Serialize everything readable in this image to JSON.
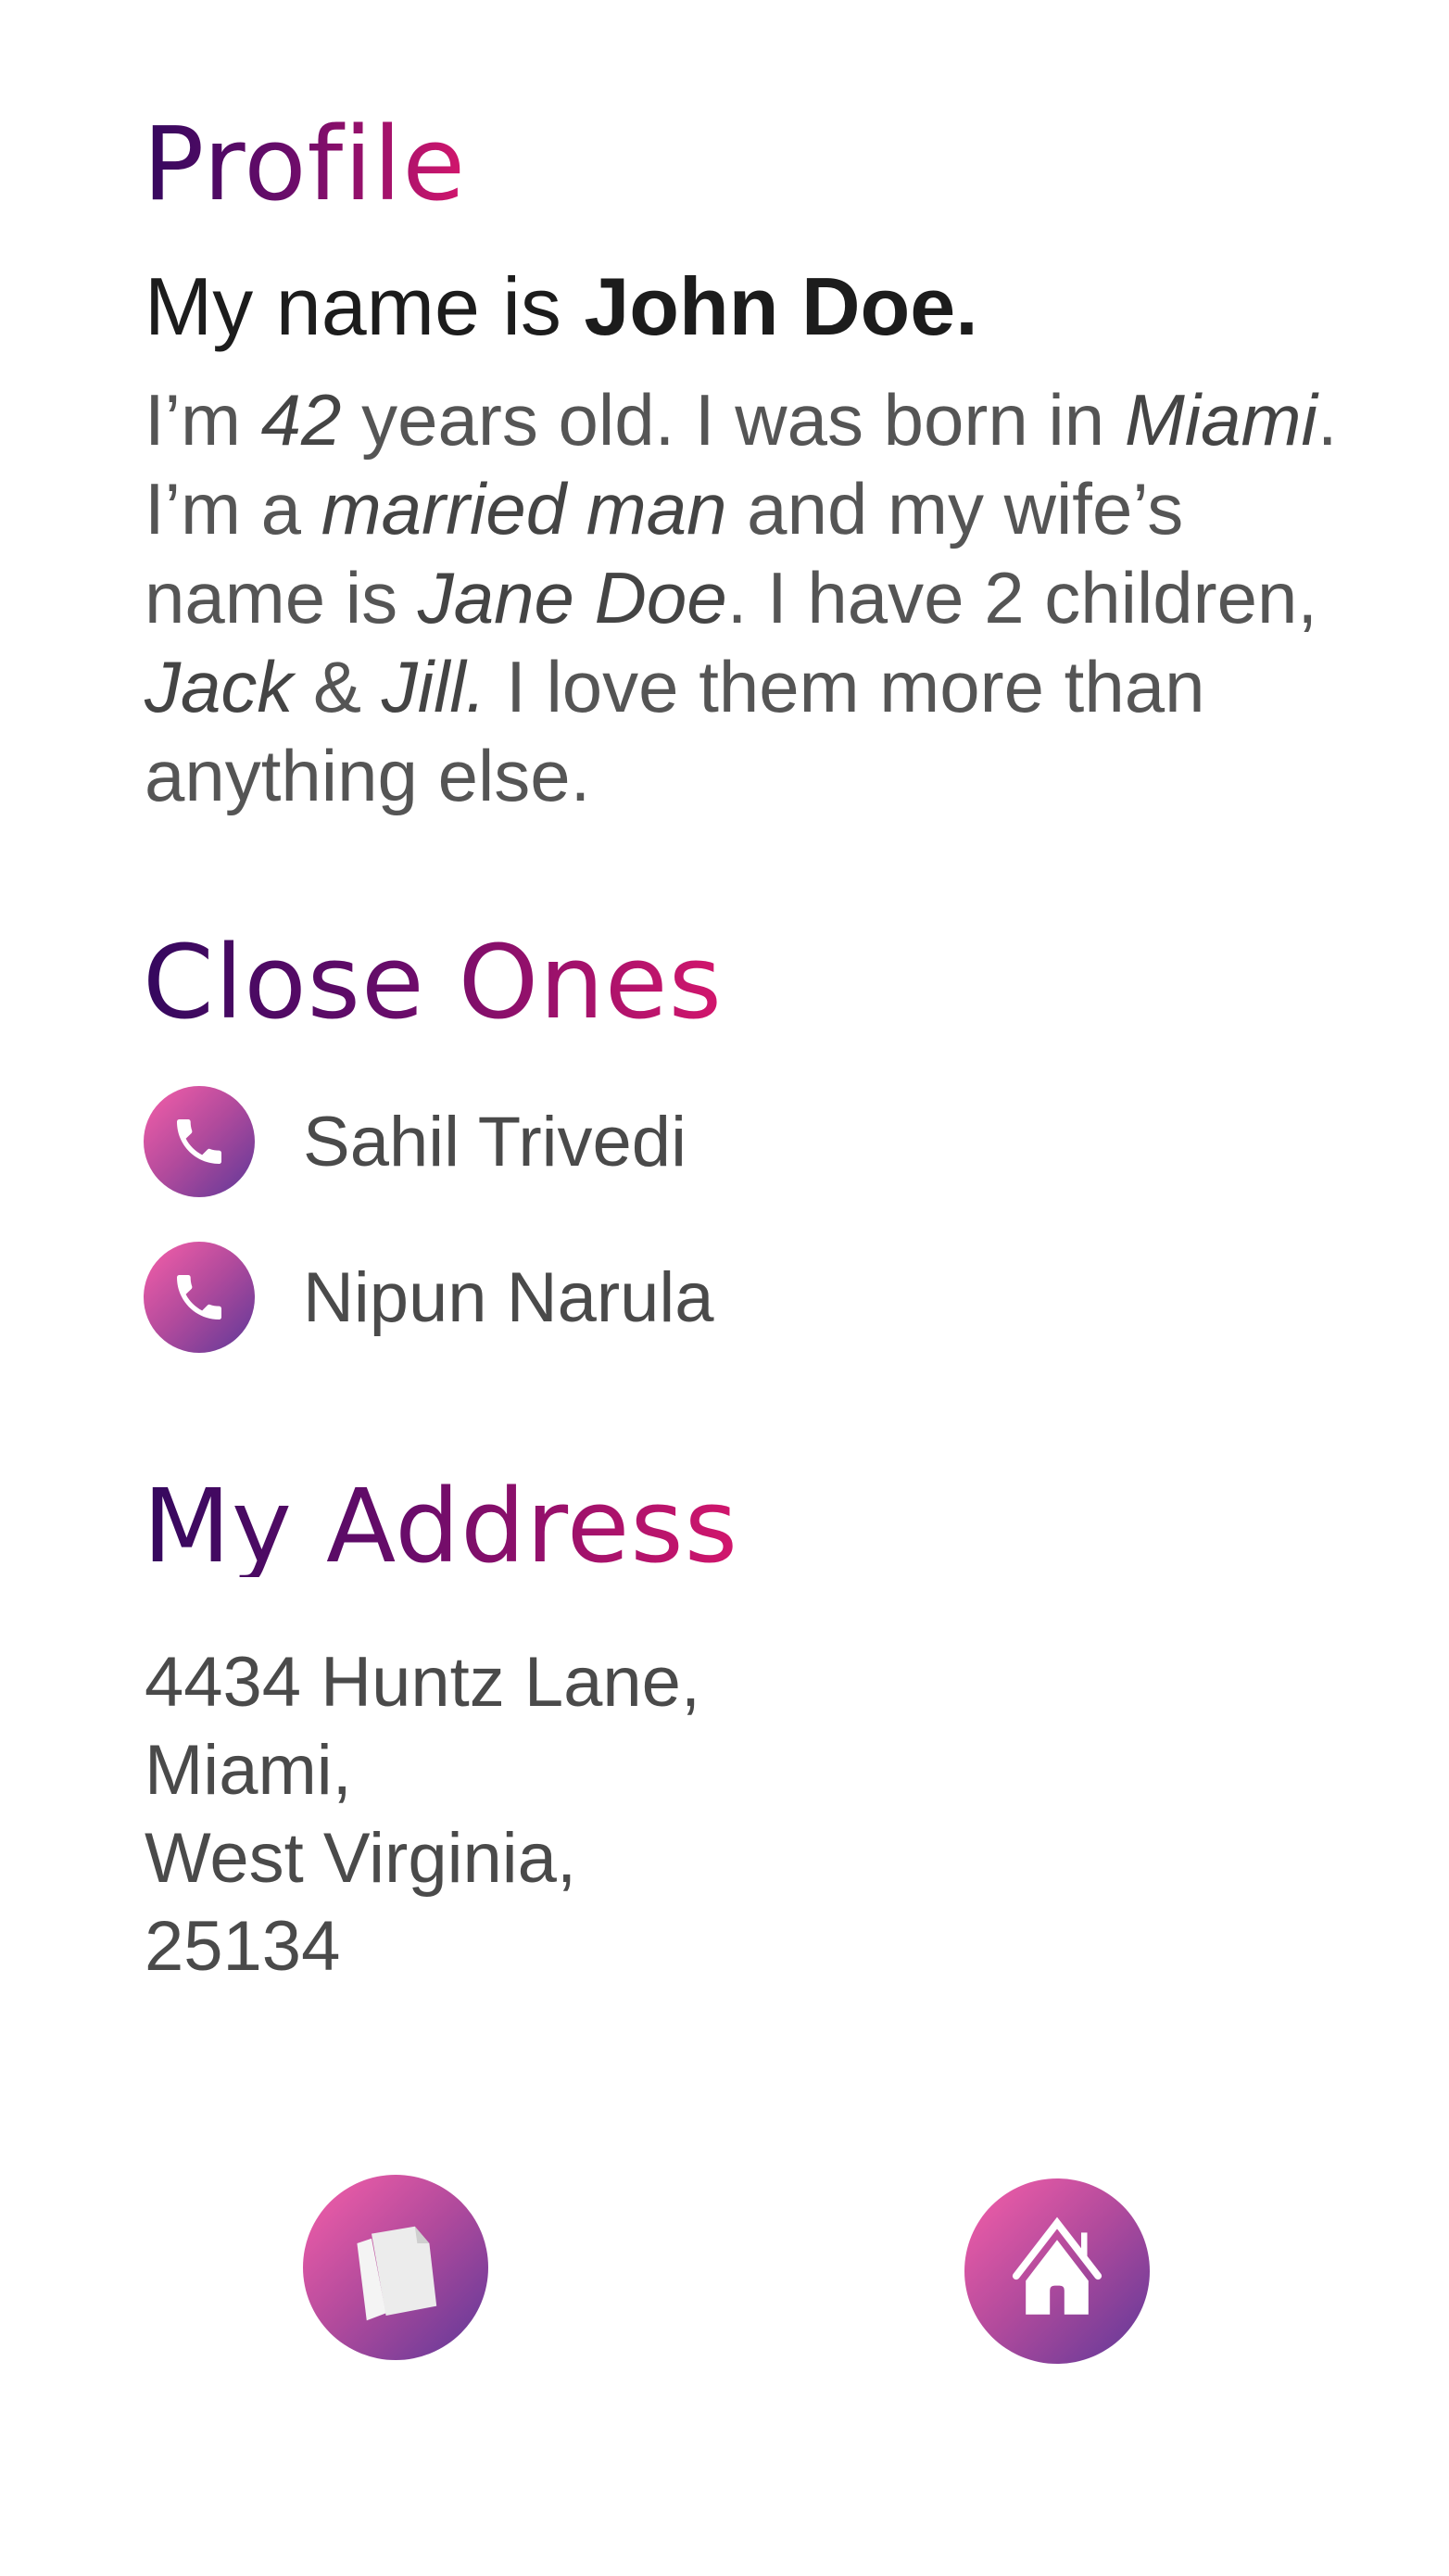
{
  "profile": {
    "title": "Profile",
    "intro_prefix": "My name is ",
    "name": "John Doe.",
    "bio": [
      {
        "text": "I’m ",
        "italic": false
      },
      {
        "text": "42",
        "italic": true
      },
      {
        "text": " years old. I was born in ",
        "italic": false
      },
      {
        "text": "Miami",
        "italic": true
      },
      {
        "text": ". I’m a ",
        "italic": false
      },
      {
        "text": "married man",
        "italic": true
      },
      {
        "text": " and my wife’s name is ",
        "italic": false
      },
      {
        "text": "Jane Doe",
        "italic": true
      },
      {
        "text": ". I have 2 children, ",
        "italic": false
      },
      {
        "text": "Jack",
        "italic": true
      },
      {
        "text": " & ",
        "italic": false
      },
      {
        "text": "Jill.",
        "italic": true
      },
      {
        "text": " I love them more than anything else.",
        "italic": false
      }
    ]
  },
  "close_ones": {
    "title": "Close Ones",
    "contacts": [
      {
        "name": "Sahil Trivedi",
        "icon": "phone-icon"
      },
      {
        "name": "Nipun Narula",
        "icon": "phone-icon"
      }
    ]
  },
  "address": {
    "title": "My Address",
    "lines": [
      "4434 Huntz Lane,",
      "Miami,",
      "West Virginia,",
      "25134"
    ]
  },
  "bottom_nav": [
    {
      "icon": "documents-icon"
    },
    {
      "icon": "home-icon"
    }
  ],
  "colors": {
    "heading_gradient": [
      "#34085e",
      "#d3166c"
    ],
    "button_gradient": [
      "#f75fa9",
      "#5e3898"
    ],
    "text": "#4a4a4a"
  }
}
